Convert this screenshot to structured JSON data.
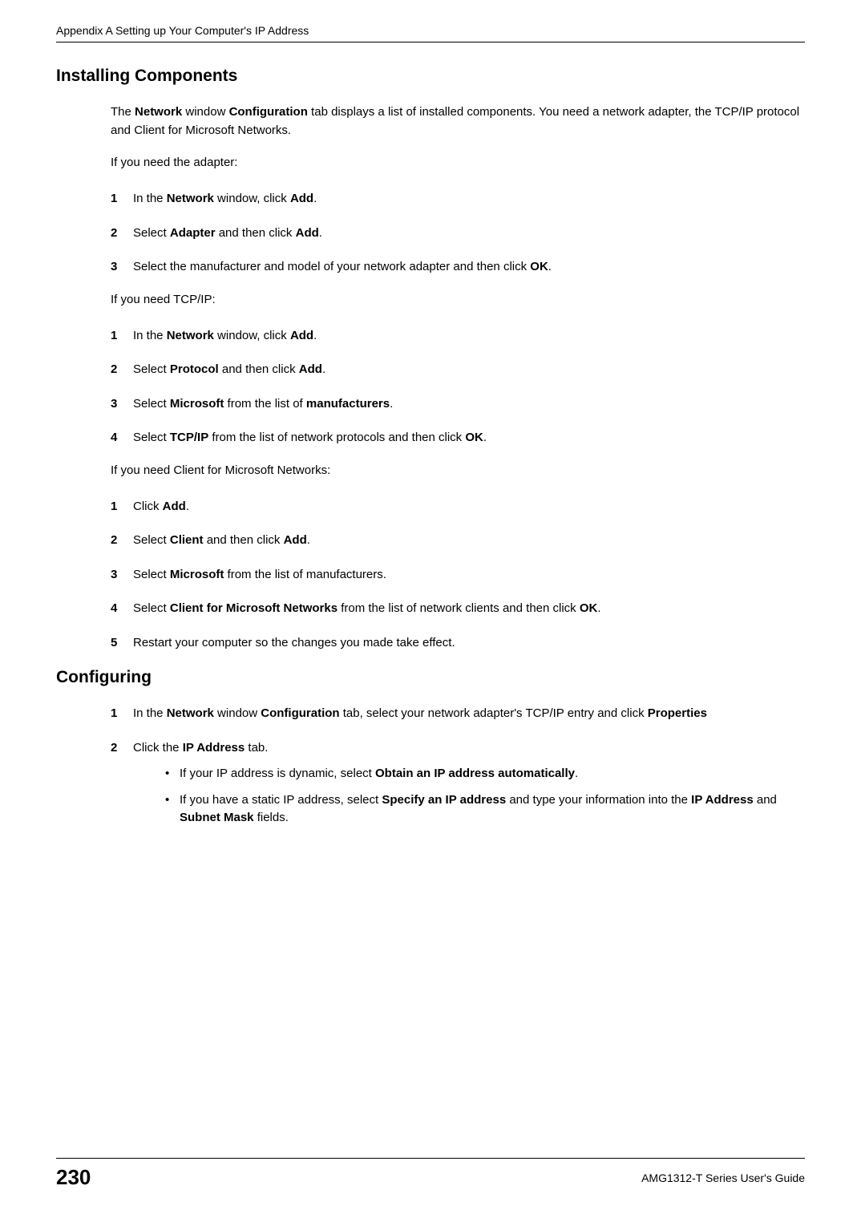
{
  "header": "Appendix A Setting up Your Computer's IP Address",
  "section1": {
    "title": "Installing Components",
    "intro_prefix": "The ",
    "intro_bold1": "Network",
    "intro_mid1": " window ",
    "intro_bold2": "Configuration",
    "intro_suffix": " tab displays a list of installed components. You need a network adapter, the TCP/IP protocol and Client for Microsoft Networks.",
    "if1": "If you need the adapter:",
    "steps1": [
      {
        "num": "1",
        "parts": [
          "In the ",
          "Network",
          " window, click ",
          "Add",
          "."
        ]
      },
      {
        "num": "2",
        "parts": [
          "Select ",
          "Adapter",
          " and then click ",
          "Add",
          "."
        ]
      },
      {
        "num": "3",
        "parts": [
          "Select the manufacturer and model of your network adapter and then click ",
          "OK",
          "."
        ]
      }
    ],
    "if2": "If you need TCP/IP:",
    "steps2": [
      {
        "num": "1",
        "parts": [
          "In the ",
          "Network",
          " window, click ",
          "Add",
          "."
        ]
      },
      {
        "num": "2",
        "parts": [
          "Select ",
          "Protocol",
          " and then click ",
          "Add",
          "."
        ]
      },
      {
        "num": "3",
        "parts": [
          "Select ",
          "Microsoft",
          " from the list of ",
          "manufacturers",
          "."
        ]
      },
      {
        "num": "4",
        "parts": [
          "Select ",
          "TCP/IP",
          " from the list of network protocols and then click ",
          "OK",
          "."
        ]
      }
    ],
    "if3": "If you need Client for Microsoft Networks:",
    "steps3": [
      {
        "num": "1",
        "parts": [
          "Click ",
          "Add",
          "."
        ]
      },
      {
        "num": "2",
        "parts": [
          "Select ",
          "Client",
          " and then click ",
          "Add",
          "."
        ]
      },
      {
        "num": "3",
        "parts": [
          "Select ",
          "Microsoft",
          " from the list of manufacturers."
        ]
      },
      {
        "num": "4",
        "parts": [
          "Select ",
          "Client for Microsoft Networks",
          " from the list of network clients and then click ",
          "OK",
          "."
        ]
      },
      {
        "num": "5",
        "parts": [
          "Restart your computer so the changes you made take effect."
        ]
      }
    ]
  },
  "section2": {
    "title": "Configuring",
    "steps": [
      {
        "num": "1",
        "parts": [
          "In the ",
          "Network",
          " window ",
          "Configuration",
          " tab, select your network adapter's TCP/IP entry and click ",
          "Properties"
        ]
      },
      {
        "num": "2",
        "parts": [
          "Click the ",
          "IP Address",
          " tab."
        ],
        "bullets": [
          {
            "parts": [
              "If your IP address is dynamic, select ",
              "Obtain an IP address automatically",
              "."
            ]
          },
          {
            "parts": [
              "If you have a static IP address, select ",
              "Specify an IP address",
              " and type your information into the ",
              "IP Address",
              " and ",
              "Subnet Mask",
              " fields."
            ]
          }
        ]
      }
    ]
  },
  "footer": {
    "page": "230",
    "guide": "AMG1312-T Series User's Guide"
  }
}
